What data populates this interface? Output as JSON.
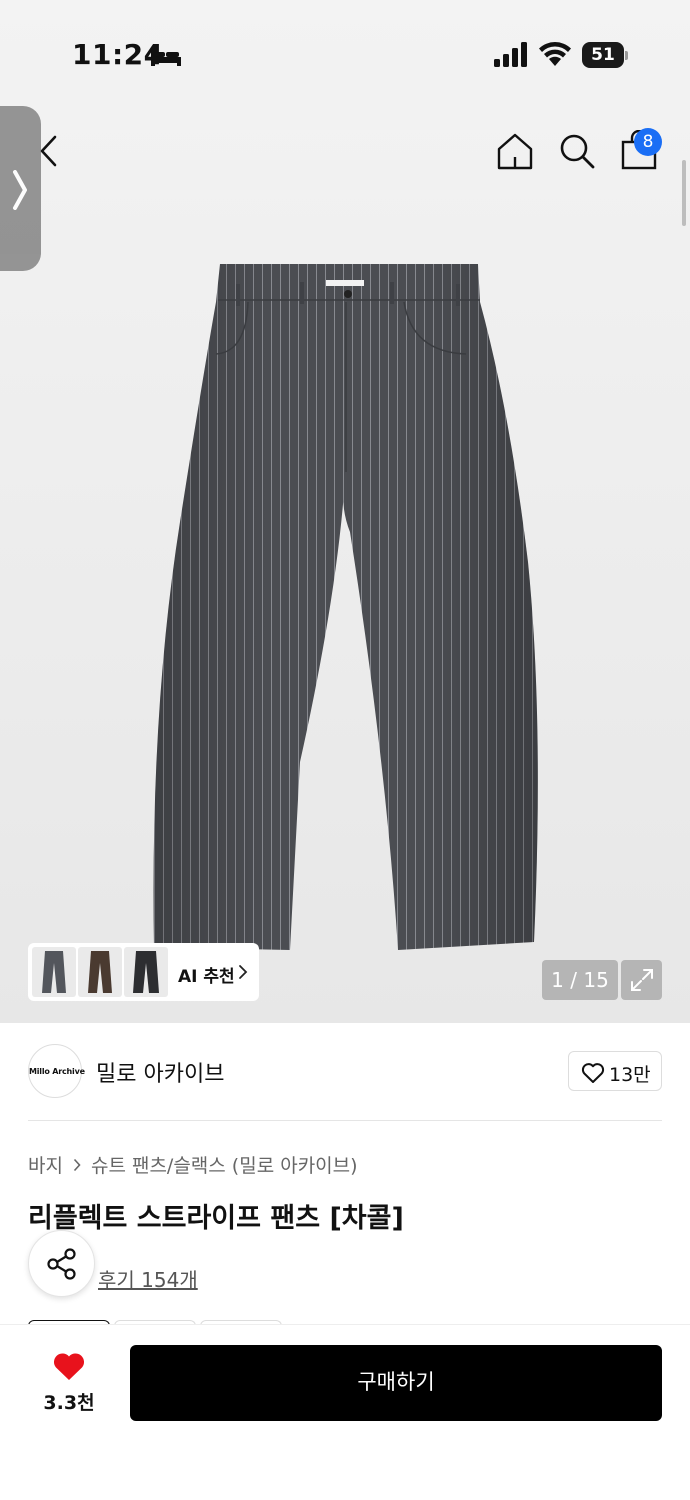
{
  "status_bar": {
    "time": "11:24",
    "battery_level": "51",
    "icons": [
      "bed-icon",
      "cellular-signal-icon",
      "wifi-icon",
      "battery-icon"
    ]
  },
  "header": {
    "icons": [
      "chevron-left-icon",
      "home-icon",
      "search-icon",
      "shopping-bag-icon"
    ],
    "cart_badge": "8"
  },
  "gallery": {
    "ai_recommend_label": "AI 추천",
    "page_counter": "1 / 15",
    "thumbnail_count": 3
  },
  "seller": {
    "logo_text": "Millo Archive",
    "name": "밀로 아카이브",
    "like_count": "13만"
  },
  "product": {
    "breadcrumb": [
      "바지",
      "슈트 팬츠/슬랙스 (밀로 아카이브)"
    ],
    "title": "리플렉트 스트라이프 팬츠 [차콜]",
    "review_link": "후기 154개"
  },
  "bottom_bar": {
    "wish_count": "3.3천",
    "buy_label": "구매하기"
  },
  "colors": {
    "accent_blue": "#1a6ef5",
    "heart_red": "#e8121c",
    "buy_button": "#000000",
    "pants_charcoal": "#4b4d52"
  }
}
